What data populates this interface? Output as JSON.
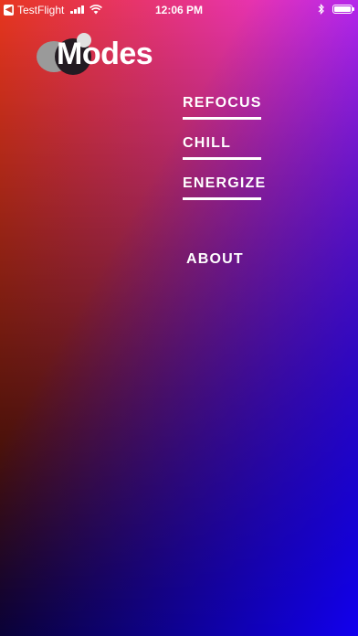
{
  "status_bar": {
    "back_app": "TestFlight",
    "time": "12:06 PM"
  },
  "logo": {
    "text": "Modes"
  },
  "menu": {
    "items": [
      {
        "label": "REFOCUS"
      },
      {
        "label": "CHILL"
      },
      {
        "label": "ENERGIZE"
      }
    ],
    "about_label": "ABOUT"
  },
  "theme": {
    "gradient_corners": {
      "top_left": "#e8361f",
      "top_right": "#e632ea",
      "bottom_left": "#0a0000",
      "bottom_right": "#1200ef"
    },
    "text_color": "#ffffff"
  },
  "icons": {
    "back": "back-arrow-icon",
    "signal": "signal-icon",
    "wifi": "wifi-icon",
    "bluetooth": "bluetooth-icon",
    "battery": "battery-icon"
  },
  "battery_level": 1.0
}
